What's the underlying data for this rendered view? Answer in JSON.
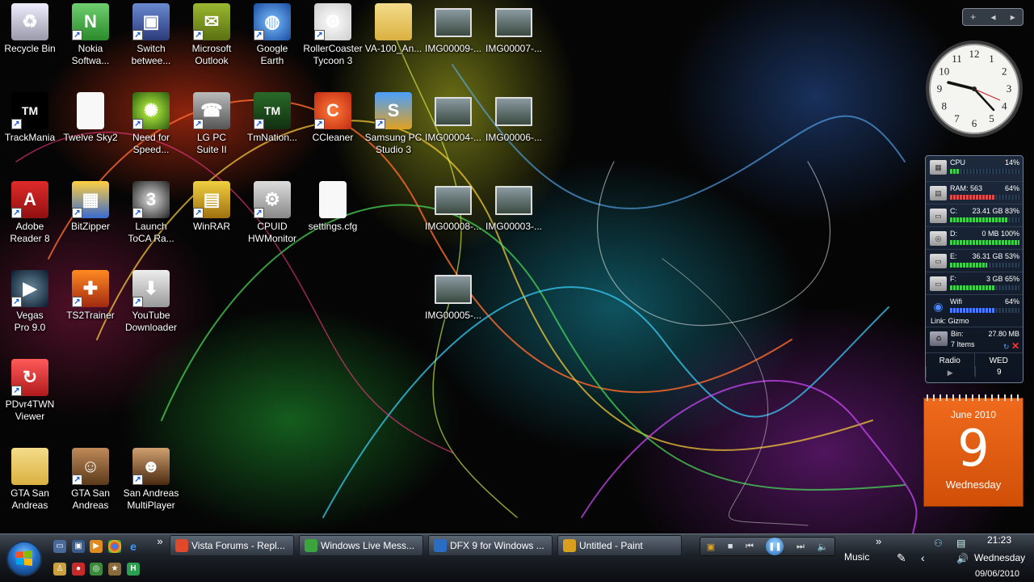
{
  "desktop": {
    "icons": [
      {
        "label": "Recycle Bin",
        "icon": "recycle-bin-icon"
      },
      {
        "label": "Nokia Softwa...",
        "icon": "nokia-icon"
      },
      {
        "label": "Switch betwee...",
        "icon": "switch-windows-icon"
      },
      {
        "label": "Microsoft Outlook",
        "icon": "outlook-icon"
      },
      {
        "label": "Google Earth",
        "icon": "google-earth-icon"
      },
      {
        "label": "RollerCoaster Tycoon 3",
        "icon": "panda-icon"
      },
      {
        "label": "VA-100_An...",
        "icon": "folder-icon"
      },
      {
        "label": "IMG00009-...",
        "icon": "image-thumbnail-icon"
      },
      {
        "label": "IMG00007-...",
        "icon": "image-thumbnail-icon"
      },
      {
        "label": "TrackMania",
        "icon": "trackmania-icon"
      },
      {
        "label": "Twelve Sky2",
        "icon": "document-icon"
      },
      {
        "label": "Need for Speed...",
        "icon": "nfs-icon"
      },
      {
        "label": "LG PC Suite II",
        "icon": "phone-icon"
      },
      {
        "label": "TmNation...",
        "icon": "tmnation-icon"
      },
      {
        "label": "CCleaner",
        "icon": "ccleaner-icon"
      },
      {
        "label": "Samsung PC Studio 3",
        "icon": "samsung-icon"
      },
      {
        "label": "IMG00004-...",
        "icon": "image-thumbnail-icon"
      },
      {
        "label": "IMG00006-...",
        "icon": "image-thumbnail-icon"
      },
      {
        "label": "Adobe Reader 8",
        "icon": "adobe-reader-icon"
      },
      {
        "label": "BitZipper",
        "icon": "bitzipper-icon"
      },
      {
        "label": "Launch ToCA Ra...",
        "icon": "toca-icon"
      },
      {
        "label": "WinRAR",
        "icon": "winrar-icon"
      },
      {
        "label": "CPUID HWMonitor",
        "icon": "hwmonitor-icon"
      },
      {
        "label": "settings.cfg",
        "icon": "document-icon"
      },
      {
        "label": "IMG00008-...",
        "icon": "image-thumbnail-icon"
      },
      {
        "label": "IMG00003-...",
        "icon": "image-thumbnail-icon"
      },
      {
        "label": "Vegas Pro 9.0",
        "icon": "vegas-icon"
      },
      {
        "label": "TS2Trainer",
        "icon": "ts2trainer-icon"
      },
      {
        "label": "YouTube Downloader",
        "icon": "youtube-downloader-icon"
      },
      {
        "label": "IMG00005-...",
        "icon": "image-thumbnail-icon"
      },
      {
        "label": "PDvr4TWN Viewer",
        "icon": "pdvr-icon"
      },
      {
        "label": "GTA San Andreas",
        "icon": "folder-icon"
      },
      {
        "label": "GTA San Andreas",
        "icon": "gta-icon"
      },
      {
        "label": "San Andreas MultiPlayer",
        "icon": "samp-icon"
      }
    ]
  },
  "sidebar": {
    "controls": [
      "+",
      "◂",
      "▸"
    ],
    "clock": {
      "numbers": [
        "12",
        "1",
        "2",
        "3",
        "4",
        "5",
        "6",
        "7",
        "8",
        "9",
        "10",
        "11"
      ]
    },
    "meter": {
      "cpu": {
        "label": "CPU",
        "value": "14%",
        "level": 14
      },
      "ram": {
        "label": "RAM: 563",
        "value": "64%",
        "level": 64
      },
      "c": {
        "label": "C:",
        "value": "23.41 GB 83%",
        "level": 83
      },
      "d": {
        "label": "D:",
        "value": "0 MB 100%",
        "level": 100
      },
      "e": {
        "label": "E:",
        "value": "36.31 GB 53%",
        "level": 53
      },
      "f": {
        "label": "F:",
        "value": "3 GB 65%",
        "level": 65
      },
      "wifi": {
        "label": "Wifi",
        "value": "64%",
        "level": 64,
        "link": "Link: Gizmo"
      },
      "bin": {
        "label": "Bin:",
        "size": "27.80 MB",
        "items": "7 Items"
      },
      "radio": {
        "label": "Radio",
        "play": "▶"
      },
      "date": {
        "weekday": "WED",
        "day": "9"
      }
    },
    "calendar": {
      "month": "June 2010",
      "day": "9",
      "weekday": "Wednesday"
    }
  },
  "taskbar": {
    "tasks": [
      {
        "label": "Vista Forums - Repl...",
        "icon": "chrome-icon",
        "color": "#e04a2a"
      },
      {
        "label": "Windows Live Mess...",
        "icon": "messenger-icon",
        "color": "#3ca43c"
      },
      {
        "label": "DFX 9 for Windows ...",
        "icon": "dfx-icon",
        "color": "#2b6cc4"
      },
      {
        "label": "Untitled - Paint",
        "icon": "paint-icon",
        "color": "#d9a020"
      }
    ],
    "overflow": "»",
    "music_label": "Music",
    "time": "21:23",
    "weekday": "Wednesday",
    "date": "09/06/2010"
  }
}
